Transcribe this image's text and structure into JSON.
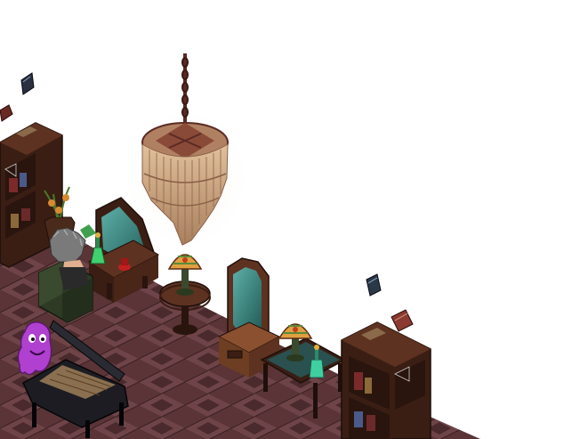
{
  "scene": {
    "kind": "isometric-room",
    "background": "#ffffff",
    "palette": {
      "floor_dark": "#4a2a2c",
      "floor_mid": "#6e4448",
      "floor_light": "#8a5a5c",
      "wood_dark": "#3a1e14",
      "wood_mid": "#5e3220",
      "wood_light": "#8a5030",
      "chandelier_fringe": "#d6b08c",
      "chandelier_shade": "#a87e5e",
      "mirror_glass": "#3c8a84",
      "lamp_shade": "#e0a040",
      "potion_green": "#40d070",
      "ghost_purple": "#b040d0",
      "piano_black": "#1c1c22",
      "armchair_green": "#2e3a24",
      "hair_gray": "#7a7a7a"
    }
  },
  "objects": [
    {
      "name": "chandelier",
      "interactable": true
    },
    {
      "name": "left-bookcase",
      "interactable": true
    },
    {
      "name": "right-bookcase",
      "interactable": true
    },
    {
      "name": "vanity-dresser-with-mirror",
      "interactable": true
    },
    {
      "name": "standing-mirror-cabinet",
      "interactable": true
    },
    {
      "name": "tiffany-lamp-round-table",
      "interactable": true
    },
    {
      "name": "tiffany-lamp-coffee-table",
      "interactable": true
    },
    {
      "name": "grand-piano",
      "interactable": true
    },
    {
      "name": "armchair",
      "interactable": true
    },
    {
      "name": "avatar-gray-hair",
      "interactable": true
    },
    {
      "name": "ghost-pet",
      "interactable": true
    },
    {
      "name": "potted-plant",
      "interactable": true
    },
    {
      "name": "floating-book-1",
      "interactable": true
    },
    {
      "name": "floating-book-2",
      "interactable": true
    },
    {
      "name": "floating-book-3",
      "interactable": true
    },
    {
      "name": "floating-book-4",
      "interactable": true
    }
  ]
}
